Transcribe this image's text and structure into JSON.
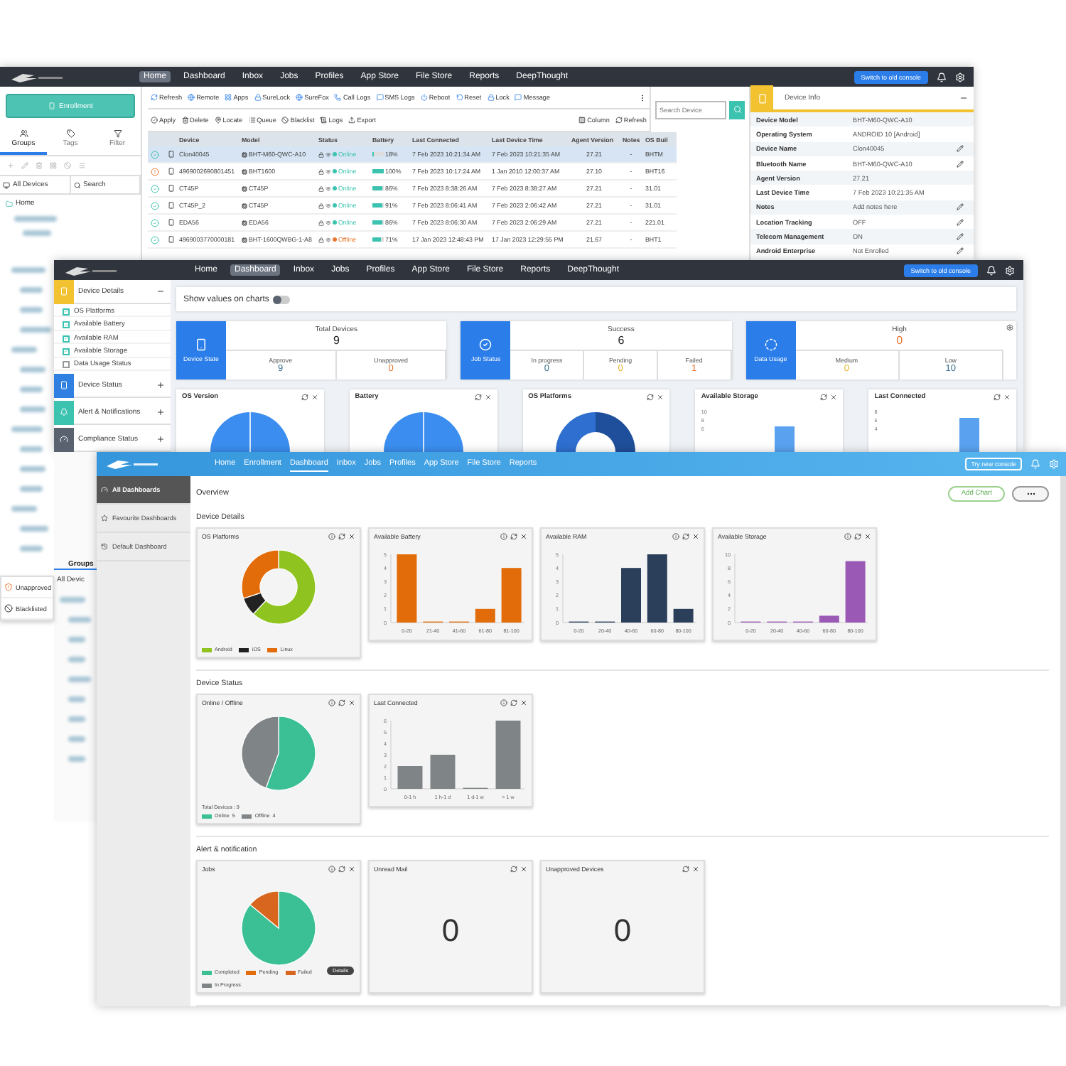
{
  "console": {
    "nav": [
      {
        "label": "Home",
        "selected": true
      },
      {
        "label": "Dashboard",
        "selected": false
      },
      {
        "label": "Inbox",
        "selected": false
      },
      {
        "label": "Jobs",
        "selected": false
      },
      {
        "label": "Profiles",
        "selected": false
      },
      {
        "label": "App Store",
        "selected": false
      },
      {
        "label": "File Store",
        "selected": false
      },
      {
        "label": "Reports",
        "selected": false
      },
      {
        "label": "DeepThought",
        "selected": false
      }
    ],
    "switch_button": "Switch to old console",
    "enrollment_button": "Enrollment",
    "panel_tabs": [
      {
        "label": "Groups",
        "selected": true
      },
      {
        "label": "Tags",
        "selected": false
      },
      {
        "label": "Filter",
        "selected": false
      }
    ],
    "all_devices": "All Devices",
    "group_search": "Search",
    "tree_root": "Home",
    "toolbar_primary": [
      "Refresh",
      "Remote",
      "Apps",
      "SureLock",
      "SureFox",
      "Call Logs",
      "SMS Logs",
      "Reboot",
      "Reset",
      "Lock",
      "Message"
    ],
    "toolbar_secondary": [
      "Apply",
      "Delete",
      "Locate",
      "Queue",
      "Blacklist",
      "Logs",
      "Export"
    ],
    "toolbar_view": [
      "Column",
      "Refresh"
    ],
    "search": {
      "placeholder": "Search Device"
    },
    "table": {
      "columns": [
        "Device",
        "Model",
        "Status",
        "Battery",
        "Last Connected",
        "Last Device Time",
        "Agent Version",
        "Notes",
        "OS Buil"
      ],
      "rows": [
        {
          "alert": false,
          "selected": true,
          "device": "Clon40045",
          "model": "BHT-M60-QWC-A10",
          "online": true,
          "status": "Online",
          "battery": "18%",
          "level": 0.18,
          "last_connected": "7 Feb 2023 10:21:34 AM",
          "last_device_time": "7 Feb 2023 10:21:35 AM",
          "agent": "27.21",
          "notes": "-",
          "os": "BHTM"
        },
        {
          "alert": true,
          "selected": false,
          "device": "4969002690801451",
          "model": "BHT1600",
          "online": true,
          "status": "Online",
          "battery": "100%",
          "level": 1,
          "last_connected": "7 Feb 2023 10:17:24 AM",
          "last_device_time": "1 Jan 2010 12:00:37 AM",
          "agent": "27.10",
          "notes": "-",
          "os": "BHT16"
        },
        {
          "alert": false,
          "selected": false,
          "device": "CT45P",
          "model": "CT45P",
          "online": true,
          "status": "Online",
          "battery": "86%",
          "level": 0.86,
          "last_connected": "7 Feb 2023 8:38:26 AM",
          "last_device_time": "7 Feb 2023 8:38:27 AM",
          "agent": "27.21",
          "notes": "-",
          "os": "31.01"
        },
        {
          "alert": false,
          "selected": false,
          "device": "CT45P_2",
          "model": "CT45P",
          "online": true,
          "status": "Online",
          "battery": "91%",
          "level": 0.91,
          "last_connected": "7 Feb 2023 8:06:41 AM",
          "last_device_time": "7 Feb 2023 2:06:42 AM",
          "agent": "27.21",
          "notes": "-",
          "os": "31.01"
        },
        {
          "alert": false,
          "selected": false,
          "device": "EDA56",
          "model": "EDA56",
          "online": true,
          "status": "Online",
          "battery": "86%",
          "level": 0.86,
          "last_connected": "7 Feb 2023 8:06:30 AM",
          "last_device_time": "7 Feb 2023 2:06:29 AM",
          "agent": "27.21",
          "notes": "-",
          "os": "221.01"
        },
        {
          "alert": false,
          "selected": false,
          "device": "4969003770000181",
          "model": "BHT-1600QWBG-1-A8",
          "online": false,
          "status": "Offline",
          "battery": "71%",
          "level": 0.71,
          "last_connected": "17 Jan 2023 12:48:43 PM",
          "last_device_time": "17 Jan 2023 12:29:55 PM",
          "agent": "21.67",
          "notes": "-",
          "os": "BHT1"
        }
      ]
    },
    "device_info": {
      "title": "Device Info",
      "fields": [
        {
          "label": "Device Model",
          "value": "BHT-M60-QWC-A10",
          "editable": false
        },
        {
          "label": "Operating System",
          "value": "ANDROID 10 [Android]",
          "editable": false
        },
        {
          "label": "Device Name",
          "value": "Clon40045",
          "editable": true
        },
        {
          "label": "Bluetooth Name",
          "value": "BHT-M60-QWC-A10",
          "editable": true
        },
        {
          "label": "Agent Version",
          "value": "27.21",
          "editable": false
        },
        {
          "label": "Last Device Time",
          "value": "7 Feb 2023 10:21:35 AM",
          "editable": false
        },
        {
          "label": "Notes",
          "value": "Add notes here",
          "editable": true
        },
        {
          "label": "Location Tracking",
          "value": "OFF",
          "editable": true
        },
        {
          "label": "Telecom Management",
          "value": "ON",
          "editable": true
        },
        {
          "label": "Android Enterprise",
          "value": "Not Enrolled",
          "editable": true
        }
      ]
    }
  },
  "left_strip": {
    "menu": [
      "Unapproved",
      "Blacklisted"
    ]
  },
  "dashboard": {
    "nav": [
      {
        "label": "Home",
        "selected": false
      },
      {
        "label": "Dashboard",
        "selected": true
      },
      {
        "label": "Inbox",
        "selected": false
      },
      {
        "label": "Jobs",
        "selected": false
      },
      {
        "label": "Profiles",
        "selected": false
      },
      {
        "label": "App Store",
        "selected": false
      },
      {
        "label": "File Store",
        "selected": false
      },
      {
        "label": "Reports",
        "selected": false
      },
      {
        "label": "DeepThought",
        "selected": false
      }
    ],
    "switch_button": "Switch to old console",
    "sidebar": [
      {
        "title": "Device Details",
        "color": "#f2c230",
        "expanded": true,
        "items": [
          {
            "label": "OS Platforms",
            "checked": true
          },
          {
            "label": "Available Battery",
            "checked": true
          },
          {
            "label": "Available RAM",
            "checked": true
          },
          {
            "label": "Available Storage",
            "checked": true
          },
          {
            "label": "Data Usage Status",
            "checked": false
          }
        ]
      },
      {
        "title": "Device Status",
        "color": "#2f80e0",
        "expanded": false
      },
      {
        "title": "Alert & Notifications",
        "color": "#3cc3b0",
        "expanded": false
      },
      {
        "title": "Compliance Status",
        "color": "#5a6270",
        "expanded": false
      }
    ],
    "toggle": {
      "label": "Show values on charts",
      "on": false
    },
    "summaries": [
      {
        "tile": "Device State",
        "title": "Total Devices",
        "value": "9",
        "color": "#222222",
        "stats": [
          {
            "label": "Approve",
            "value": "9",
            "color": "#3a6f8f"
          },
          {
            "label": "Unapproved",
            "value": "0",
            "color": "#e8772e"
          }
        ]
      },
      {
        "tile": "Job Status",
        "title": "Success",
        "value": "6",
        "color": "#222222",
        "stats": [
          {
            "label": "In progress",
            "value": "0",
            "color": "#3a6f8f"
          },
          {
            "label": "Pending",
            "value": "0",
            "color": "#e8b52e"
          },
          {
            "label": "Failed",
            "value": "1",
            "color": "#e8772e"
          }
        ]
      },
      {
        "tile": "Data Usage",
        "title": "High",
        "value": "0",
        "color": "#e8772e",
        "stats": [
          {
            "label": "Medium",
            "value": "0",
            "color": "#e8b52e"
          },
          {
            "label": "Low",
            "value": "10",
            "color": "#3a6f8f"
          }
        ]
      }
    ],
    "chart_cards": [
      {
        "title": "OS Version",
        "kind": "pie"
      },
      {
        "title": "Battery",
        "kind": "pie"
      },
      {
        "title": "OS Platforms",
        "kind": "donut"
      },
      {
        "title": "Available Storage",
        "kind": "bar",
        "ticks": [
          "10",
          "8",
          "6"
        ]
      },
      {
        "title": "Last Connected",
        "kind": "bar",
        "ticks": [
          "8",
          "6",
          "4"
        ]
      }
    ]
  },
  "groups_strip": {
    "tab": "Groups",
    "all_devices": "All Devic"
  },
  "enterprise": {
    "nav": [
      {
        "label": "Home",
        "selected": false
      },
      {
        "label": "Enrollment",
        "selected": false
      },
      {
        "label": "Dashboard",
        "selected": true
      },
      {
        "label": "Inbox",
        "selected": false
      },
      {
        "label": "Jobs",
        "selected": false
      },
      {
        "label": "Profiles",
        "selected": false
      },
      {
        "label": "App Store",
        "selected": false
      },
      {
        "label": "File Store",
        "selected": false
      },
      {
        "label": "Reports",
        "selected": false
      }
    ],
    "try_button": "Try new console",
    "sidebar": [
      {
        "label": "All Dashboards",
        "selected": true
      },
      {
        "label": "Favourite Dashboards",
        "selected": false
      },
      {
        "label": "Default Dashboard",
        "selected": false
      }
    ],
    "page_title": "Overview",
    "add_button": "Add Chart",
    "sections": [
      {
        "title": "Device Details",
        "cards": [
          {
            "title": "OS Platforms",
            "kind": "donut",
            "info": true,
            "legend": [
              {
                "label": "Android",
                "color": "#8fc31f"
              },
              {
                "label": "iOS",
                "color": "#222222"
              },
              {
                "label": "Linux",
                "color": "#e36c0a"
              }
            ]
          },
          {
            "title": "Available Battery",
            "kind": "bar",
            "info": true,
            "chart_data": {
              "type": "bar",
              "categories": [
                "0-20",
                "21-40",
                "41-60",
                "61-80",
                "81-100"
              ],
              "series": [
                {
                  "color": "#e36c0a",
                  "values": [
                    5,
                    0,
                    0,
                    1,
                    4
                  ]
                }
              ],
              "ylim": [
                0,
                5
              ],
              "yticks": [
                0,
                1,
                2,
                3,
                4,
                5
              ]
            }
          },
          {
            "title": "Available RAM",
            "kind": "bar",
            "info": true,
            "chart_data": {
              "type": "bar",
              "categories": [
                "0-20",
                "20-40",
                "40-60",
                "60-80",
                "80-100"
              ],
              "series": [
                {
                  "color": "#2b3e5a",
                  "values": [
                    0,
                    0,
                    4,
                    5,
                    1
                  ]
                }
              ],
              "ylim": [
                0,
                5
              ],
              "yticks": [
                0,
                1,
                2,
                3,
                4,
                5
              ]
            }
          },
          {
            "title": "Available Storage",
            "kind": "bar",
            "info": true,
            "chart_data": {
              "type": "bar",
              "categories": [
                "0-20",
                "20-40",
                "40-60",
                "60-80",
                "80-100"
              ],
              "series": [
                {
                  "color": "#9b59b6",
                  "values": [
                    0,
                    0,
                    0,
                    1,
                    9
                  ]
                }
              ],
              "ylim": [
                0,
                10
              ],
              "yticks": [
                0,
                2,
                4,
                6,
                8,
                10
              ]
            }
          }
        ]
      },
      {
        "title": "Device Status",
        "cards": [
          {
            "title": "Online / Offline",
            "kind": "pie",
            "info": true,
            "total": "Total Devices :  9",
            "legend": [
              {
                "label": "Online",
                "count": "5",
                "color": "#3bbf95"
              },
              {
                "label": "Offline",
                "count": "4",
                "color": "#7f8487"
              }
            ]
          },
          {
            "title": "Last Connected",
            "kind": "bar",
            "info": true,
            "chart_data": {
              "type": "bar",
              "categories": [
                "0-1 h",
                "1 h-1 d",
                "1 d-1 w",
                "> 1 w"
              ],
              "series": [
                {
                  "color": "#7f8487",
                  "values": [
                    2,
                    3,
                    0,
                    6
                  ]
                }
              ],
              "ylim": [
                0,
                6
              ],
              "yticks": [
                0,
                1,
                2,
                3,
                4,
                5,
                6
              ]
            }
          }
        ]
      },
      {
        "title": "Alert & notification",
        "cards": [
          {
            "title": "Jobs",
            "kind": "jobs",
            "info": true,
            "details": "Details",
            "legend": [
              {
                "label": "Completed",
                "color": "#3bbf95"
              },
              {
                "label": "Pending",
                "color": "#e36c0a"
              },
              {
                "label": "Failed",
                "color": "#d9661f"
              },
              {
                "label": "In Progress",
                "color": "#7f8487"
              }
            ]
          },
          {
            "title": "Unread Mail",
            "kind": "count",
            "info": false,
            "count": "0"
          },
          {
            "title": "Unapproved Devices",
            "kind": "count",
            "info": false,
            "count": "0"
          }
        ]
      }
    ]
  }
}
